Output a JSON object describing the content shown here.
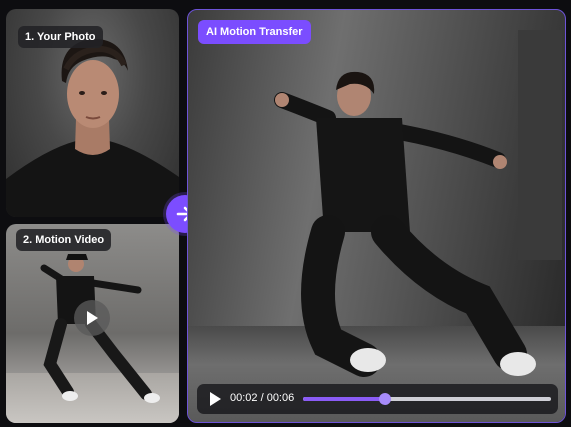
{
  "photo_card": {
    "label": "1. Your Photo"
  },
  "video_card": {
    "label": "2. Motion Video"
  },
  "result_card": {
    "label": "AI Motion Transfer"
  },
  "player": {
    "time": "00:02 / 00:06",
    "progress": 0.33
  },
  "icons": {
    "next": "arrow-right-icon",
    "play_overlay": "play-icon",
    "play_control": "play-icon"
  },
  "colors": {
    "accent": "#7c4dff",
    "progress": "#8b5cf6"
  }
}
